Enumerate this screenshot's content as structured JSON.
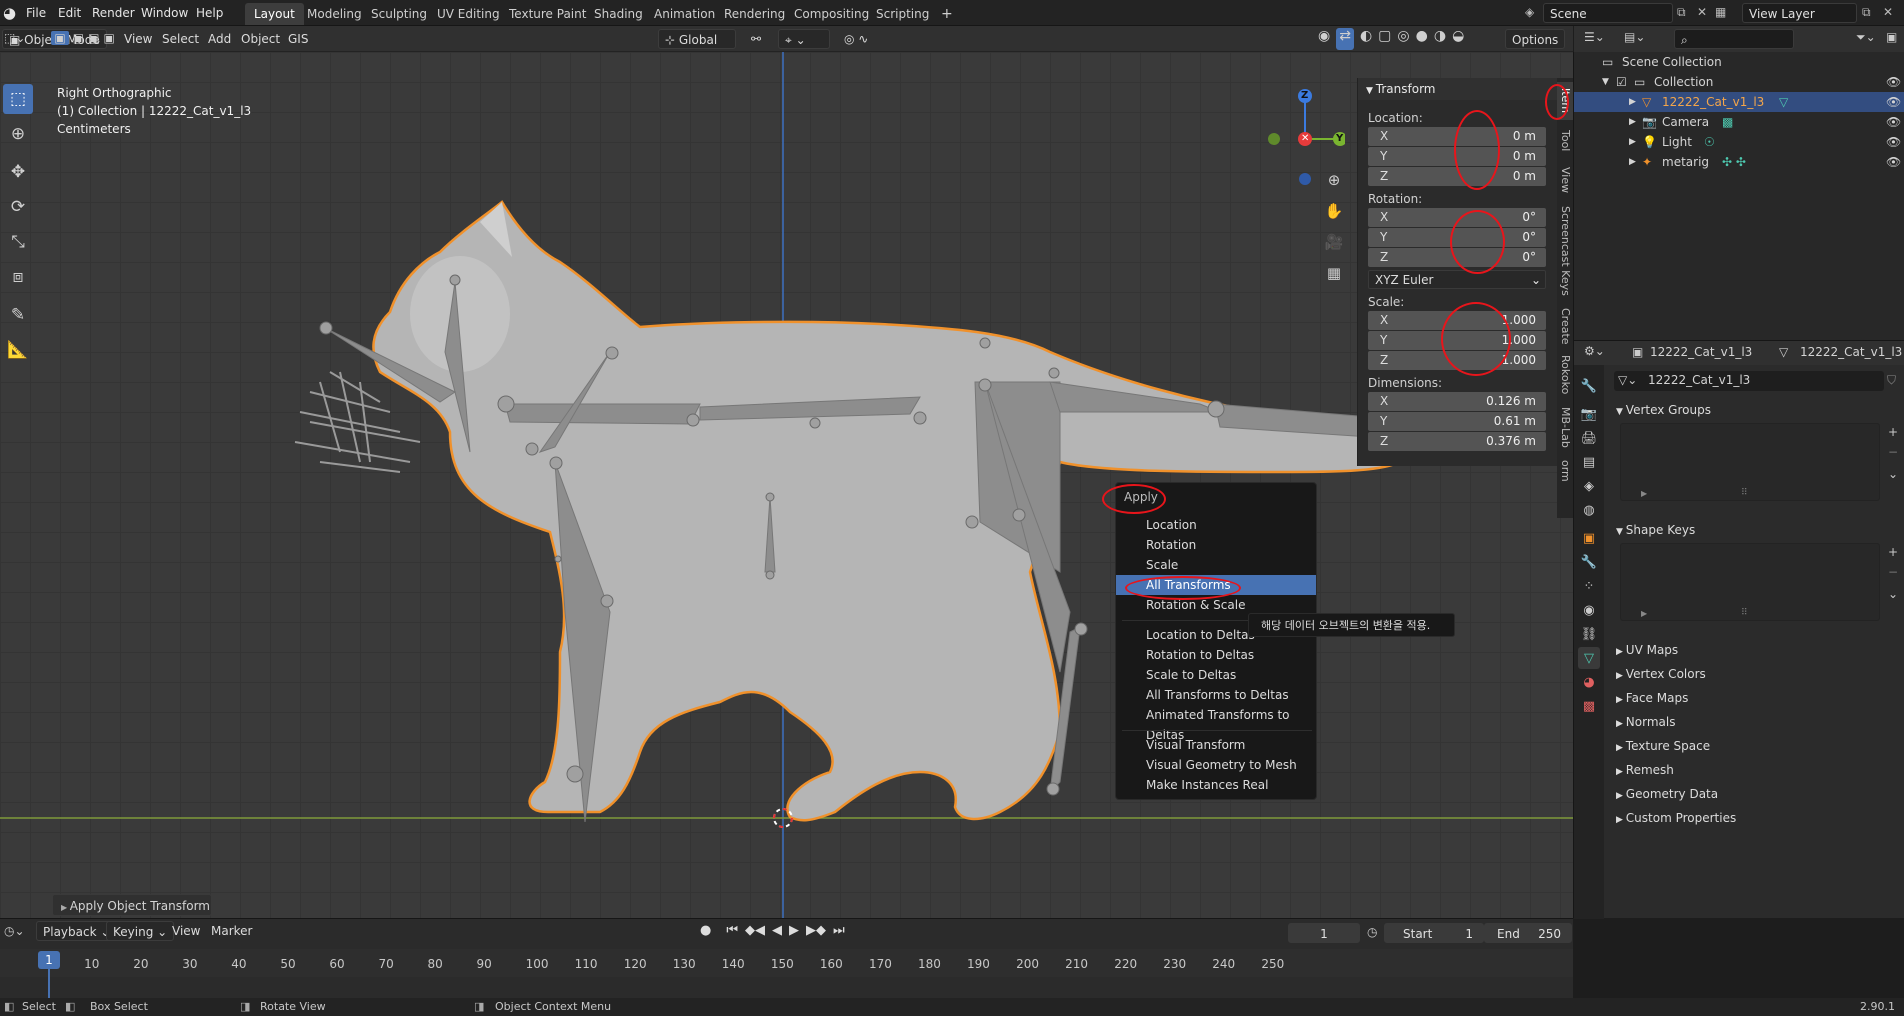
{
  "topbar": {
    "menus": [
      "File",
      "Edit",
      "Render",
      "Window",
      "Help"
    ],
    "workspaces": [
      "Layout",
      "Modeling",
      "Sculpting",
      "UV Editing",
      "Texture Paint",
      "Shading",
      "Animation",
      "Rendering",
      "Compositing",
      "Scripting"
    ],
    "add_tab": "+",
    "scene": "Scene",
    "view_layer": "View Layer"
  },
  "viewport_header": {
    "mode": "Object Mode",
    "menus": [
      "View",
      "Select",
      "Add",
      "Object",
      "GIS"
    ],
    "orientation": "Global",
    "options": "Options"
  },
  "viewport": {
    "view_name": "Right Orthographic",
    "collection_line": "(1) Collection | 12222_Cat_v1_l3",
    "units": "Centimeters",
    "gizmo": {
      "z": "Z",
      "y": "Y"
    }
  },
  "npanel": {
    "title": "Transform",
    "location_label": "Location:",
    "location": [
      {
        "axis": "X",
        "value": "0 m"
      },
      {
        "axis": "Y",
        "value": "0 m"
      },
      {
        "axis": "Z",
        "value": "0 m"
      }
    ],
    "rotation_label": "Rotation:",
    "rotation": [
      {
        "axis": "X",
        "value": "0°"
      },
      {
        "axis": "Y",
        "value": "0°"
      },
      {
        "axis": "Z",
        "value": "0°"
      }
    ],
    "rotation_mode": "XYZ Euler",
    "scale_label": "Scale:",
    "scale": [
      {
        "axis": "X",
        "value": "1.000"
      },
      {
        "axis": "Y",
        "value": "1.000"
      },
      {
        "axis": "Z",
        "value": "1.000"
      }
    ],
    "dimensions_label": "Dimensions:",
    "dimensions": [
      {
        "axis": "X",
        "value": "0.126 m"
      },
      {
        "axis": "Y",
        "value": "0.61 m"
      },
      {
        "axis": "Z",
        "value": "0.376 m"
      }
    ],
    "tabs": [
      "Item",
      "Tool",
      "View",
      "Screencast Keys",
      "Create",
      "Rokoko",
      "MB-Lab",
      "orm"
    ]
  },
  "apply_menu": {
    "title": "Apply",
    "items": [
      "Location",
      "Rotation",
      "Scale",
      "All Transforms",
      "Rotation & Scale"
    ],
    "delta_items": [
      "Location to Deltas",
      "Rotation to Deltas",
      "Scale to Deltas",
      "All Transforms to Deltas",
      "Animated Transforms to Deltas"
    ],
    "visual_items": [
      "Visual Transform",
      "Visual Geometry to Mesh",
      "Make Instances Real"
    ],
    "highlighted": "All Transforms",
    "tooltip": "해당 데이터 오브젝트의 변환을 적용."
  },
  "operator_panel": "Apply Object Transform",
  "outliner": {
    "root": "Scene Collection",
    "collection": "Collection",
    "items": [
      "12222_Cat_v1_l3",
      "Camera",
      "Light",
      "metarig"
    ],
    "selected": "12222_Cat_v1_l3"
  },
  "properties": {
    "object_name": "12222_Cat_v1_l3",
    "mesh_name": "12222_Cat_v1_l3",
    "data_field": "12222_Cat_v1_l3",
    "sections_open": [
      "Vertex Groups",
      "Shape Keys"
    ],
    "sections_closed": [
      "UV Maps",
      "Vertex Colors",
      "Face Maps",
      "Normals",
      "Texture Space",
      "Remesh",
      "Geometry Data",
      "Custom Properties"
    ]
  },
  "timeline": {
    "menus": [
      "Playback",
      "Keying",
      "View",
      "Marker"
    ],
    "current_frame": "1",
    "start_label": "Start",
    "start": "1",
    "end_label": "End",
    "end": "250",
    "ticks": [
      "1",
      "10",
      "20",
      "30",
      "40",
      "50",
      "60",
      "70",
      "80",
      "90",
      "100",
      "110",
      "120",
      "130",
      "140",
      "150",
      "160",
      "170",
      "180",
      "190",
      "200",
      "210",
      "220",
      "230",
      "240",
      "250"
    ]
  },
  "statusbar": {
    "select": "Select",
    "box_select": "Box Select",
    "rotate_view": "Rotate View",
    "context_menu": "Object Context Menu",
    "version": "2.90.1"
  },
  "colors": {
    "accent": "#4772b3",
    "selection_outline": "#f0912b",
    "annotation": "#e8151b"
  }
}
